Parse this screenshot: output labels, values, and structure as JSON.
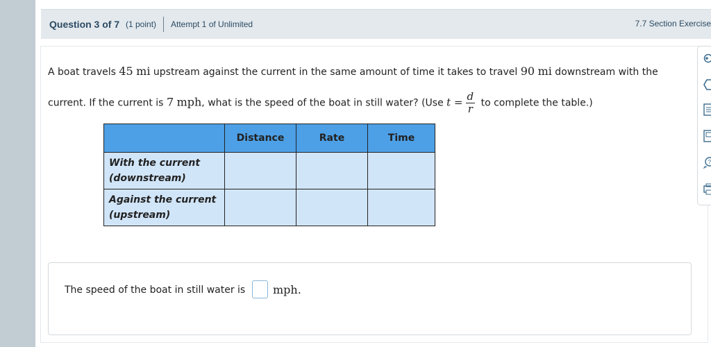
{
  "header": {
    "question": "Question 3 of 7",
    "points": "(1 point)",
    "attempt": "Attempt 1 of Unlimited",
    "section": "7.7 Section Exercise"
  },
  "problem": {
    "line1_a": "A boat travels ",
    "dist1": "45",
    "unit_mi": "mi",
    "line1_b": " upstream against the current in the same amount of time it takes to travel ",
    "dist2": "90",
    "line1_c": " downstream with the",
    "line2_a": "current. If the current is ",
    "current": "7",
    "unit_mph": "mph",
    "line2_b": ", what is the speed of the boat in still water? (Use ",
    "formula_t": "t =",
    "frac_num": "d",
    "frac_den": "r",
    "line2_c": " to complete the table.)"
  },
  "table": {
    "headers": [
      "Distance",
      "Rate",
      "Time"
    ],
    "rows": [
      {
        "label1": "With the current",
        "label2": "(downstream)"
      },
      {
        "label1": "Against the current",
        "label2": "(upstream)"
      }
    ]
  },
  "answer": {
    "text": "The speed of the boat in still water is",
    "unit": "mph",
    "period": ".",
    "value": ""
  },
  "toolbar": {
    "icons": [
      "eye-icon",
      "tag-icon",
      "list-icon",
      "book-icon",
      "help-icon",
      "print-icon"
    ],
    "accent": "#3b6c8f"
  },
  "colors": {
    "header_bg": "#e3e9ed",
    "table_header": "#4da0e6",
    "table_cell": "#d1e5f8",
    "rail": "#c1ccd3"
  }
}
